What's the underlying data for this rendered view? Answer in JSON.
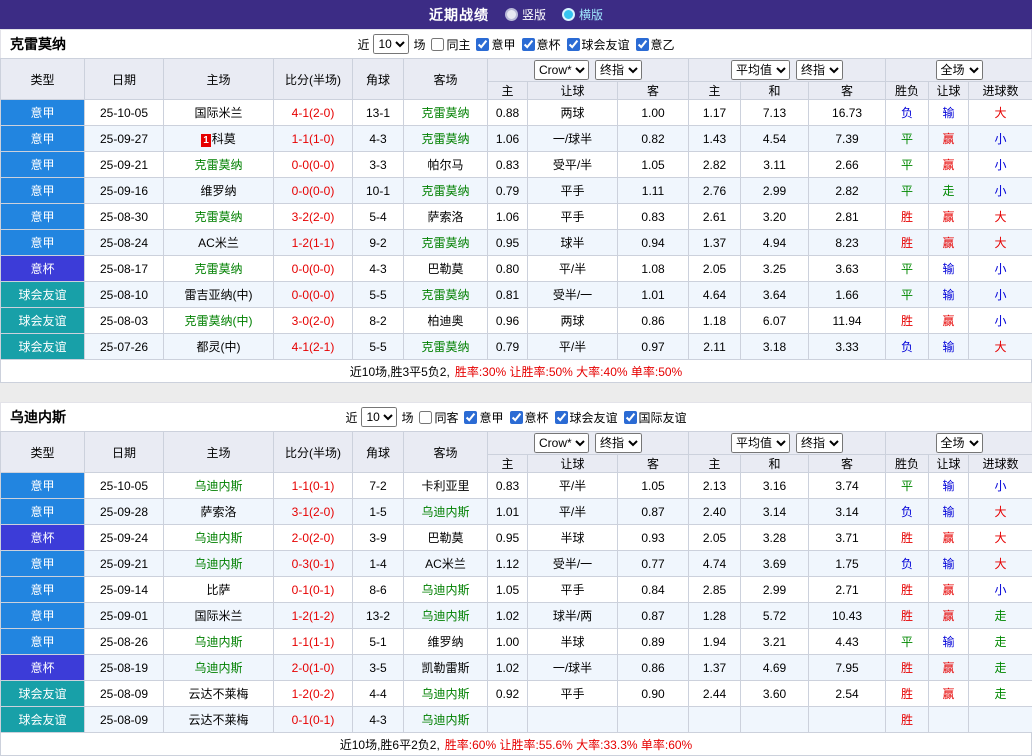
{
  "header": {
    "title": "近期战绩",
    "radio_vertical": "竖版",
    "radio_horizontal": "横版"
  },
  "type_colors": {
    "意甲": "#2285e0",
    "意杯": "#3c3cd8",
    "球会友谊": "#18a0a8"
  },
  "result_colors": {
    "胜": "red",
    "平": "green",
    "负": "blue",
    "赢": "red",
    "输": "blue",
    "走": "green",
    "大": "red",
    "小": "blue"
  },
  "table_header": {
    "base_cols": [
      "类型",
      "日期",
      "主场",
      "比分(半场)",
      "角球",
      "客场"
    ],
    "odds1_selects": [
      "Crow*",
      "终指"
    ],
    "odds2_selects": [
      "平均值",
      "终指"
    ],
    "result_select": "全场",
    "sub_cols": [
      "主",
      "让球",
      "客",
      "主",
      "和",
      "客",
      "胜负",
      "让球",
      "进球数"
    ]
  },
  "sections": [
    {
      "team": "克雷莫纳",
      "filter": {
        "near": "近",
        "count": "10",
        "games": "场",
        "same": "同主",
        "same_checked": false,
        "leagues": [
          "意甲",
          "意杯",
          "球会友谊",
          "意乙"
        ]
      },
      "rows": [
        {
          "type": "意甲",
          "date": "25-10-05",
          "home": "国际米兰",
          "home_green": false,
          "score": "4-1(2-0)",
          "corner": "13-1",
          "away": "克雷莫纳",
          "away_green": true,
          "o1": [
            "0.88",
            "两球",
            "1.00"
          ],
          "o2": [
            "1.17",
            "7.13",
            "16.73"
          ],
          "res": [
            "负",
            "输",
            "大"
          ]
        },
        {
          "type": "意甲",
          "date": "25-09-27",
          "home": "科莫",
          "home_green": false,
          "home_card": "1",
          "score": "1-1(1-0)",
          "corner": "4-3",
          "away": "克雷莫纳",
          "away_green": true,
          "o1": [
            "1.06",
            "一/球半",
            "0.82"
          ],
          "o2": [
            "1.43",
            "4.54",
            "7.39"
          ],
          "res": [
            "平",
            "赢",
            "小"
          ]
        },
        {
          "type": "意甲",
          "date": "25-09-21",
          "home": "克雷莫纳",
          "home_green": true,
          "score": "0-0(0-0)",
          "corner": "3-3",
          "away": "帕尔马",
          "away_green": false,
          "o1": [
            "0.83",
            "受平/半",
            "1.05"
          ],
          "o2": [
            "2.82",
            "3.11",
            "2.66"
          ],
          "res": [
            "平",
            "赢",
            "小"
          ]
        },
        {
          "type": "意甲",
          "date": "25-09-16",
          "home": "维罗纳",
          "home_green": false,
          "score": "0-0(0-0)",
          "corner": "10-1",
          "away": "克雷莫纳",
          "away_green": true,
          "o1": [
            "0.79",
            "平手",
            "1.11"
          ],
          "o2": [
            "2.76",
            "2.99",
            "2.82"
          ],
          "res": [
            "平",
            "走",
            "小"
          ]
        },
        {
          "type": "意甲",
          "date": "25-08-30",
          "home": "克雷莫纳",
          "home_green": true,
          "score": "3-2(2-0)",
          "corner": "5-4",
          "away": "萨索洛",
          "away_green": false,
          "o1": [
            "1.06",
            "平手",
            "0.83"
          ],
          "o2": [
            "2.61",
            "3.20",
            "2.81"
          ],
          "res": [
            "胜",
            "赢",
            "大"
          ]
        },
        {
          "type": "意甲",
          "date": "25-08-24",
          "home": "AC米兰",
          "home_green": false,
          "score": "1-2(1-1)",
          "corner": "9-2",
          "away": "克雷莫纳",
          "away_green": true,
          "o1": [
            "0.95",
            "球半",
            "0.94"
          ],
          "o2": [
            "1.37",
            "4.94",
            "8.23"
          ],
          "res": [
            "胜",
            "赢",
            "大"
          ]
        },
        {
          "type": "意杯",
          "date": "25-08-17",
          "home": "克雷莫纳",
          "home_green": true,
          "score": "0-0(0-0)",
          "corner": "4-3",
          "away": "巴勒莫",
          "away_green": false,
          "o1": [
            "0.80",
            "平/半",
            "1.08"
          ],
          "o2": [
            "2.05",
            "3.25",
            "3.63"
          ],
          "res": [
            "平",
            "输",
            "小"
          ]
        },
        {
          "type": "球会友谊",
          "date": "25-08-10",
          "home": "雷吉亚纳(中)",
          "home_green": false,
          "score": "0-0(0-0)",
          "corner": "5-5",
          "away": "克雷莫纳",
          "away_green": true,
          "o1": [
            "0.81",
            "受半/一",
            "1.01"
          ],
          "o2": [
            "4.64",
            "3.64",
            "1.66"
          ],
          "res": [
            "平",
            "输",
            "小"
          ]
        },
        {
          "type": "球会友谊",
          "date": "25-08-03",
          "home": "克雷莫纳(中)",
          "home_green": true,
          "score": "3-0(2-0)",
          "corner": "8-2",
          "away": "柏迪奥",
          "away_green": false,
          "o1": [
            "0.96",
            "两球",
            "0.86"
          ],
          "o2": [
            "1.18",
            "6.07",
            "11.94"
          ],
          "res": [
            "胜",
            "赢",
            "小"
          ]
        },
        {
          "type": "球会友谊",
          "date": "25-07-26",
          "home": "都灵(中)",
          "home_green": false,
          "score": "4-1(2-1)",
          "corner": "5-5",
          "away": "克雷莫纳",
          "away_green": true,
          "o1": [
            "0.79",
            "平/半",
            "0.97"
          ],
          "o2": [
            "2.11",
            "3.18",
            "3.33"
          ],
          "res": [
            "负",
            "输",
            "大"
          ]
        }
      ],
      "summary": {
        "record": "近10场,胜3平5负2,",
        "stats": "胜率:30% 让胜率:50% 大率:40% 单率:50%"
      }
    },
    {
      "team": "乌迪内斯",
      "filter": {
        "near": "近",
        "count": "10",
        "games": "场",
        "same": "同客",
        "same_checked": false,
        "leagues": [
          "意甲",
          "意杯",
          "球会友谊",
          "国际友谊"
        ]
      },
      "rows": [
        {
          "type": "意甲",
          "date": "25-10-05",
          "home": "乌迪内斯",
          "home_green": true,
          "score": "1-1(0-1)",
          "corner": "7-2",
          "away": "卡利亚里",
          "away_green": false,
          "o1": [
            "0.83",
            "平/半",
            "1.05"
          ],
          "o2": [
            "2.13",
            "3.16",
            "3.74"
          ],
          "res": [
            "平",
            "输",
            "小"
          ]
        },
        {
          "type": "意甲",
          "date": "25-09-28",
          "home": "萨索洛",
          "home_green": false,
          "score": "3-1(2-0)",
          "corner": "1-5",
          "away": "乌迪内斯",
          "away_green": true,
          "o1": [
            "1.01",
            "平/半",
            "0.87"
          ],
          "o2": [
            "2.40",
            "3.14",
            "3.14"
          ],
          "res": [
            "负",
            "输",
            "大"
          ]
        },
        {
          "type": "意杯",
          "date": "25-09-24",
          "home": "乌迪内斯",
          "home_green": true,
          "score": "2-0(2-0)",
          "corner": "3-9",
          "away": "巴勒莫",
          "away_green": false,
          "o1": [
            "0.95",
            "半球",
            "0.93"
          ],
          "o2": [
            "2.05",
            "3.28",
            "3.71"
          ],
          "res": [
            "胜",
            "赢",
            "大"
          ]
        },
        {
          "type": "意甲",
          "date": "25-09-21",
          "home": "乌迪内斯",
          "home_green": true,
          "score": "0-3(0-1)",
          "corner": "1-4",
          "away": "AC米兰",
          "away_green": false,
          "o1": [
            "1.12",
            "受半/一",
            "0.77"
          ],
          "o2": [
            "4.74",
            "3.69",
            "1.75"
          ],
          "res": [
            "负",
            "输",
            "大"
          ]
        },
        {
          "type": "意甲",
          "date": "25-09-14",
          "home": "比萨",
          "home_green": false,
          "score": "0-1(0-1)",
          "corner": "8-6",
          "away": "乌迪内斯",
          "away_green": true,
          "o1": [
            "1.05",
            "平手",
            "0.84"
          ],
          "o2": [
            "2.85",
            "2.99",
            "2.71"
          ],
          "res": [
            "胜",
            "赢",
            "小"
          ]
        },
        {
          "type": "意甲",
          "date": "25-09-01",
          "home": "国际米兰",
          "home_green": false,
          "score": "1-2(1-2)",
          "corner": "13-2",
          "away": "乌迪内斯",
          "away_green": true,
          "o1": [
            "1.02",
            "球半/两",
            "0.87"
          ],
          "o2": [
            "1.28",
            "5.72",
            "10.43"
          ],
          "res": [
            "胜",
            "赢",
            "走"
          ]
        },
        {
          "type": "意甲",
          "date": "25-08-26",
          "home": "乌迪内斯",
          "home_green": true,
          "score": "1-1(1-1)",
          "corner": "5-1",
          "away": "维罗纳",
          "away_green": false,
          "o1": [
            "1.00",
            "半球",
            "0.89"
          ],
          "o2": [
            "1.94",
            "3.21",
            "4.43"
          ],
          "res": [
            "平",
            "输",
            "走"
          ]
        },
        {
          "type": "意杯",
          "date": "25-08-19",
          "home": "乌迪内斯",
          "home_green": true,
          "score": "2-0(1-0)",
          "corner": "3-5",
          "away": "凯勒雷斯",
          "away_green": false,
          "o1": [
            "1.02",
            "一/球半",
            "0.86"
          ],
          "o2": [
            "1.37",
            "4.69",
            "7.95"
          ],
          "res": [
            "胜",
            "赢",
            "走"
          ]
        },
        {
          "type": "球会友谊",
          "date": "25-08-09",
          "home": "云达不莱梅",
          "home_green": false,
          "score": "1-2(0-2)",
          "corner": "4-4",
          "away": "乌迪内斯",
          "away_green": true,
          "o1": [
            "0.92",
            "平手",
            "0.90"
          ],
          "o2": [
            "2.44",
            "3.60",
            "2.54"
          ],
          "res": [
            "胜",
            "赢",
            "走"
          ]
        },
        {
          "type": "球会友谊",
          "date": "25-08-09",
          "home": "云达不莱梅",
          "home_green": false,
          "score": "0-1(0-1)",
          "corner": "4-3",
          "away": "乌迪内斯",
          "away_green": true,
          "o1": [
            "",
            "",
            ""
          ],
          "o2": [
            "",
            "",
            ""
          ],
          "res": [
            "胜",
            "",
            ""
          ]
        }
      ],
      "summary": {
        "record": "近10场,胜6平2负2,",
        "stats": "胜率:60% 让胜率:55.6% 大率:33.3% 单率:60%"
      }
    }
  ]
}
